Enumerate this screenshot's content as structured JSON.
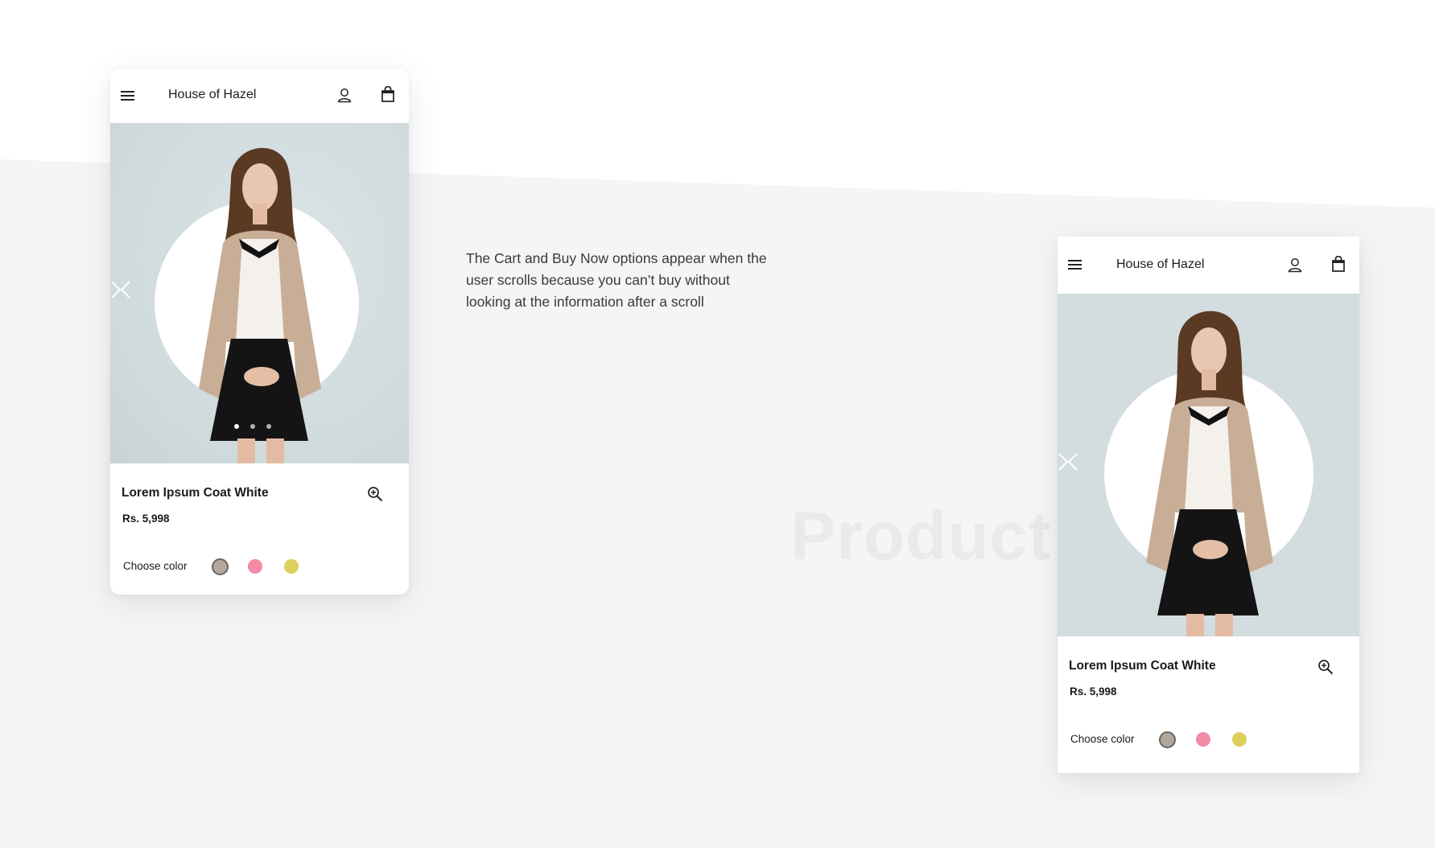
{
  "page": {
    "caption": "The Cart and Buy Now options appear when the user scrolls because you can’t buy without looking at the information after a scroll",
    "watermark": "Product P"
  },
  "colors": {
    "background_top": "#ffffff",
    "background_bottom": "#f5f5f5",
    "hero_bg": "#d3dcdf",
    "swatch_taupe": "#b3a79c",
    "swatch_pink": "#f38aa6",
    "swatch_yellow": "#dccf5c",
    "dot_active": "#ffffff",
    "dot_inactive": "#a9b4b8"
  },
  "screens": [
    {
      "header": {
        "menu_icon": "hamburger-menu-icon",
        "brand": "House of Hazel",
        "account_icon": "user-icon",
        "cart_icon": "shopping-bag-icon"
      },
      "carousel": {
        "prev_icon": "chevron-left-icon",
        "next_icon": "chevron-right-icon",
        "slide_count": 3,
        "active_slide": 1
      },
      "product": {
        "name": "Lorem Ipsum Coat White",
        "price": "Rs. 5,998",
        "zoom_icon": "zoom-in-icon"
      },
      "color_picker": {
        "label": "Choose color",
        "options": [
          "taupe",
          "pink",
          "yellow"
        ],
        "selected": "taupe"
      }
    },
    {
      "header": {
        "menu_icon": "hamburger-menu-icon",
        "brand": "House of Hazel",
        "account_icon": "user-icon",
        "cart_icon": "shopping-bag-icon"
      },
      "carousel": {
        "prev_icon": "chevron-left-icon",
        "next_icon": "chevron-right-icon"
      },
      "product": {
        "name": "Lorem Ipsum Coat White",
        "price": "Rs. 5,998",
        "zoom_icon": "zoom-in-icon"
      },
      "color_picker": {
        "label": "Choose color",
        "options": [
          "taupe",
          "pink",
          "yellow"
        ],
        "selected": "taupe"
      }
    }
  ]
}
